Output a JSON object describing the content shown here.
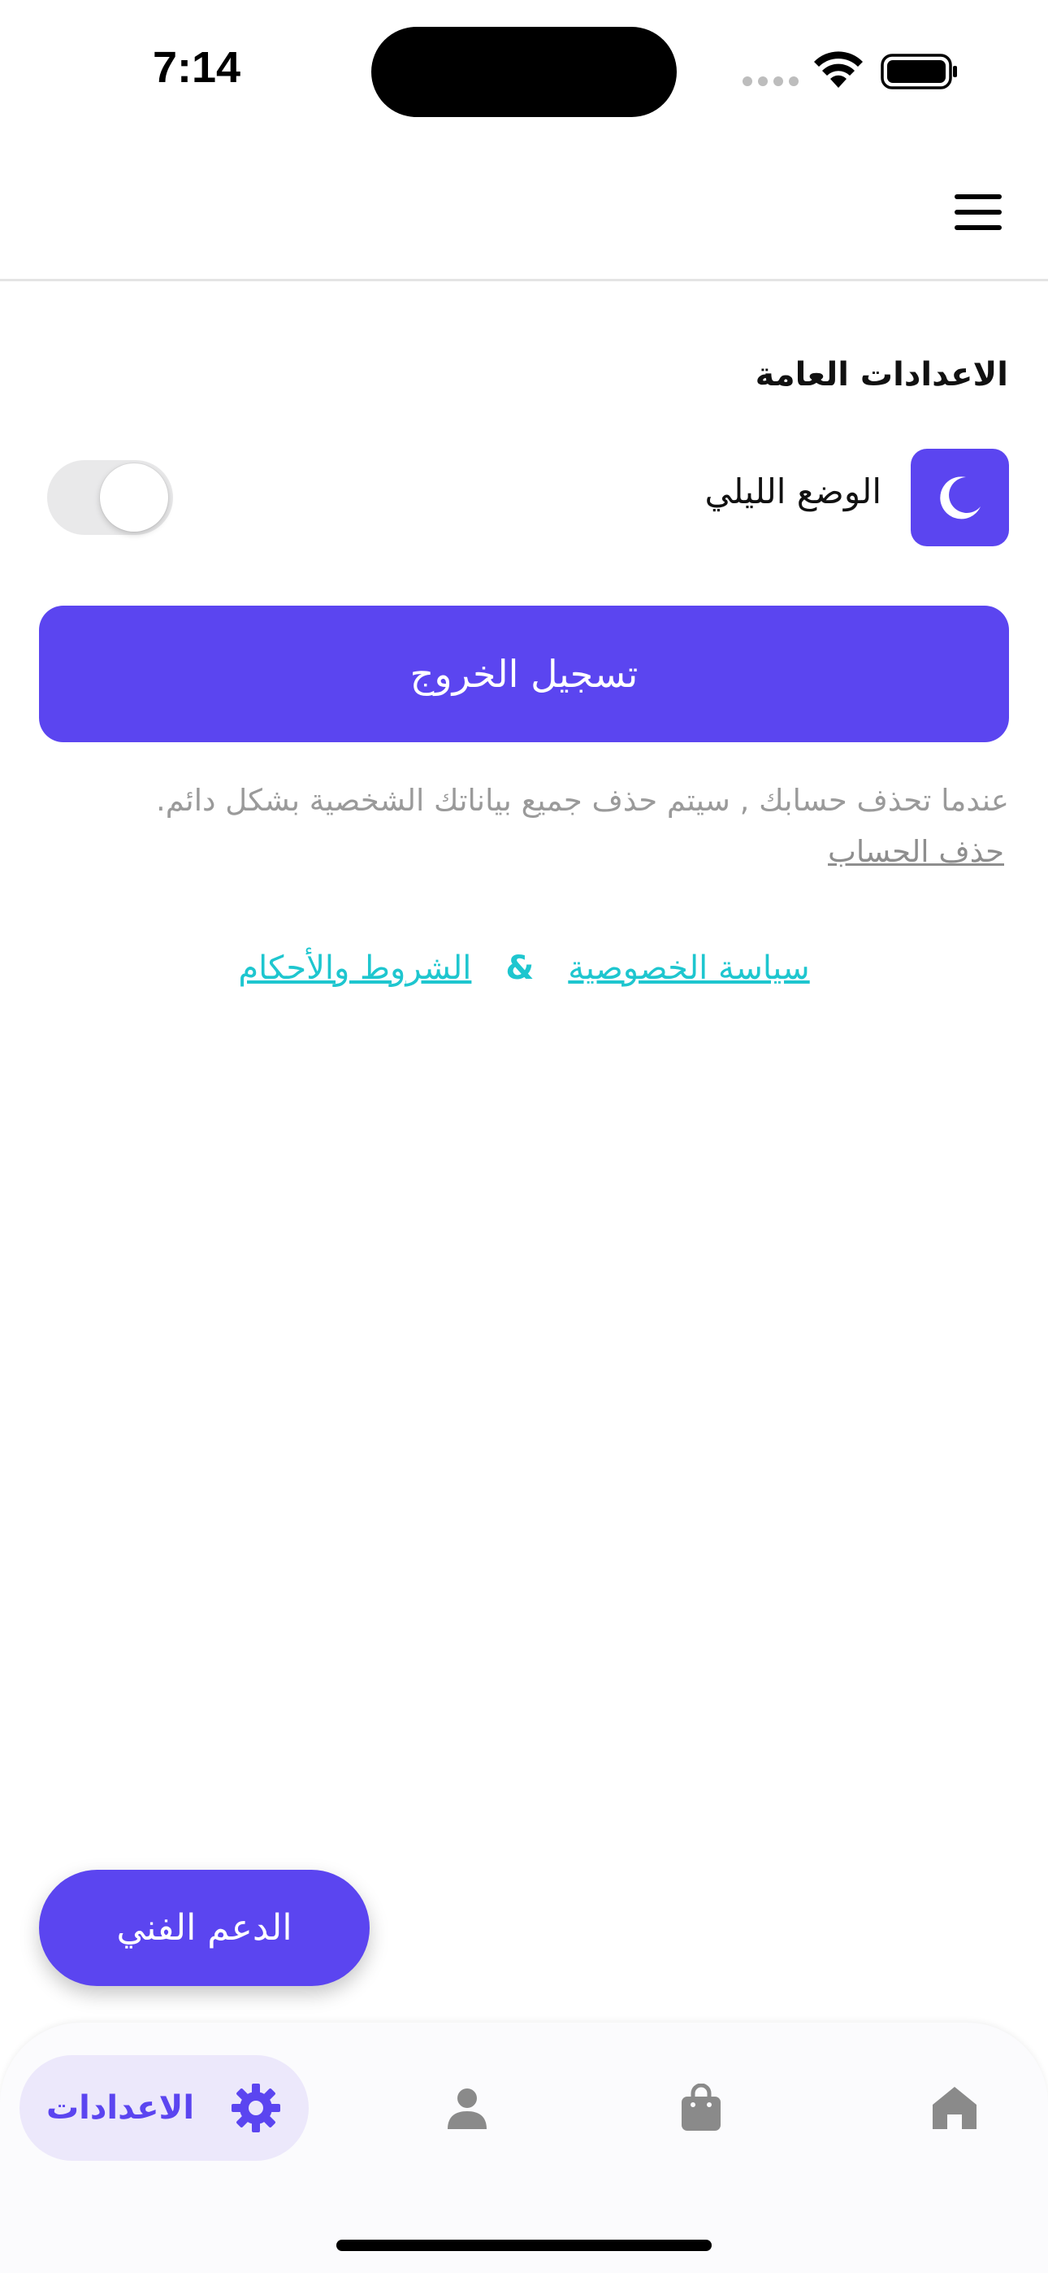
{
  "status_bar": {
    "time": "7:14"
  },
  "settings": {
    "section_title": "الاعدادات العامة",
    "dark_mode_label": "الوضع الليلي",
    "dark_mode_enabled": false,
    "logout_label": "تسجيل الخروج",
    "delete_warning": "عندما تحذف حسابك , سيتم حذف جميع بياناتك الشخصية بشكل دائم.",
    "delete_account_link": "حذف الحساب",
    "privacy_link": "سياسة الخصوصية",
    "ampersand": "&",
    "terms_link": "الشروط والأحكام"
  },
  "support_button_label": "الدعم الفني",
  "bottom_nav": {
    "items": [
      {
        "name": "home",
        "icon": "home-icon"
      },
      {
        "name": "shop",
        "icon": "shopping-bag-icon"
      },
      {
        "name": "profile",
        "icon": "person-icon"
      },
      {
        "name": "settings",
        "icon": "gear-icon",
        "label": "الاعدادات",
        "active": true
      }
    ]
  },
  "colors": {
    "primary": "#5b45f0",
    "link": "#1ec6cf",
    "muted_text": "#9a9a9a",
    "active_nav_bg": "#ece8fb"
  }
}
